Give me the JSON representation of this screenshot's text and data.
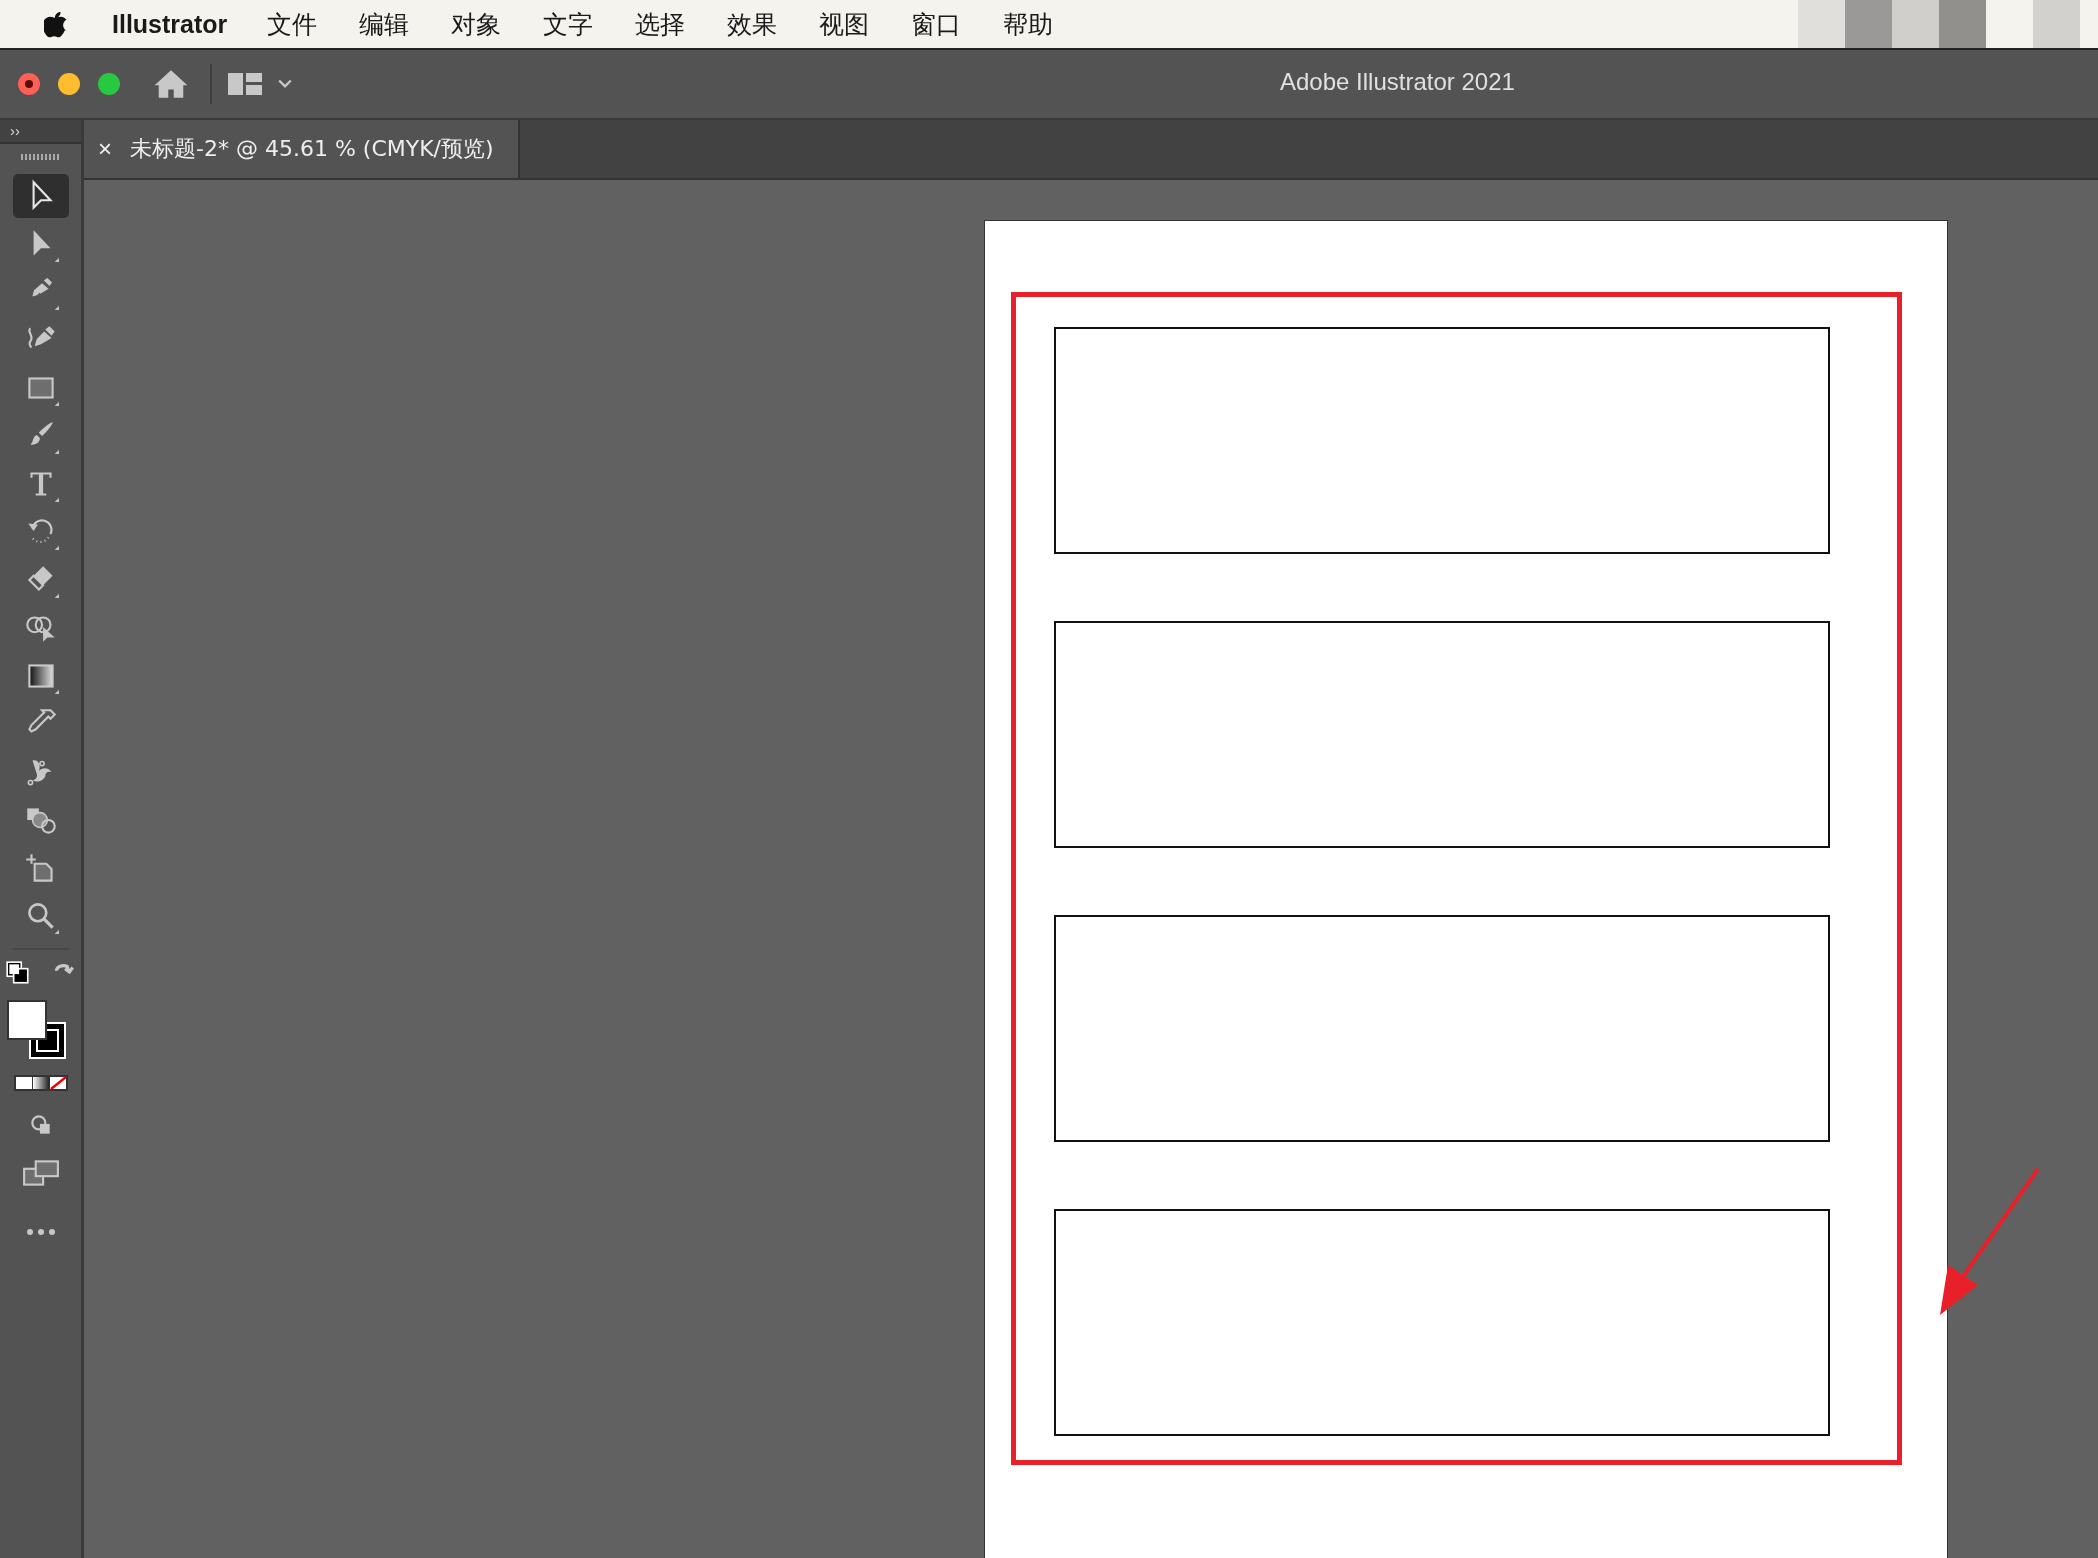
{
  "menu_bar": {
    "app_name": "Illustrator",
    "items": [
      "文件",
      "编辑",
      "对象",
      "文字",
      "选择",
      "效果",
      "视图",
      "窗口",
      "帮助"
    ]
  },
  "window": {
    "title": "Adobe Illustrator 2021"
  },
  "tabs": [
    {
      "title": "未标题-2* @ 45.61 % (CMYK/预览)",
      "close": "×",
      "selected": true
    }
  ],
  "toolbar": {
    "collapse": "››",
    "tools": [
      {
        "kind": "selection",
        "selected": true
      },
      {
        "kind": "direct-selection",
        "selected": false
      },
      {
        "kind": "pen",
        "selected": false
      },
      {
        "kind": "curvature",
        "selected": false
      },
      {
        "kind": "rectangle",
        "selected": false
      },
      {
        "kind": "brush",
        "selected": false
      },
      {
        "kind": "type",
        "selected": false
      },
      {
        "kind": "rotate",
        "selected": false
      },
      {
        "kind": "eraser",
        "selected": false
      },
      {
        "kind": "shape-builder",
        "selected": false
      },
      {
        "kind": "gradient",
        "selected": false
      },
      {
        "kind": "eyedropper",
        "selected": false
      },
      {
        "kind": "puppet-warp",
        "selected": false
      },
      {
        "kind": "blend",
        "selected": false
      },
      {
        "kind": "artboard",
        "selected": false
      },
      {
        "kind": "zoom",
        "selected": false
      }
    ]
  }
}
